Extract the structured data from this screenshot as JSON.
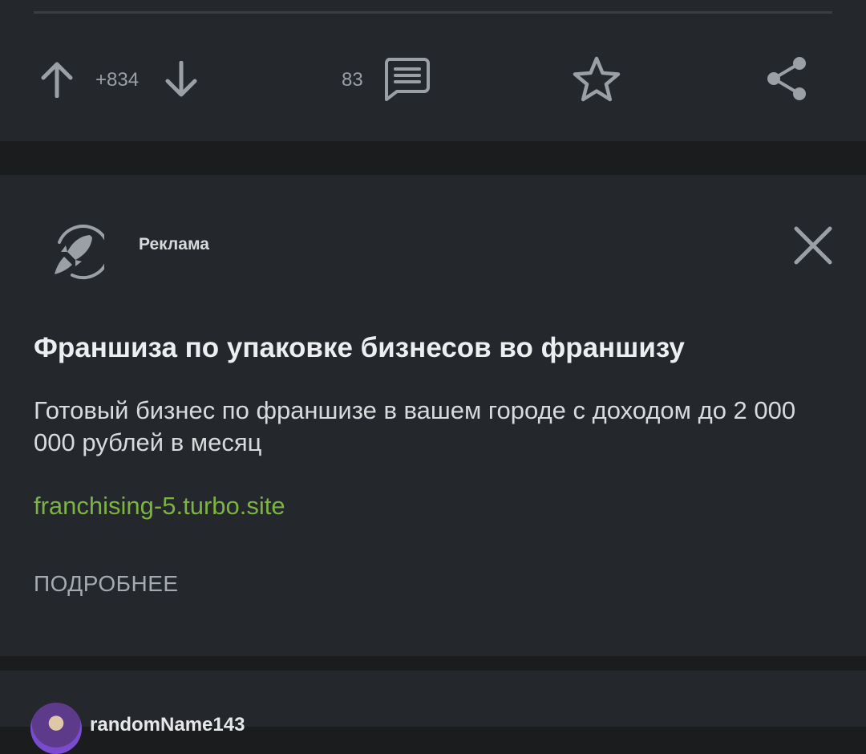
{
  "post": {
    "rating": "+834",
    "comments_count": "83",
    "icons": [
      "upvote-arrow-icon",
      "downvote-arrow-icon",
      "comments-icon",
      "star-icon",
      "share-icon"
    ]
  },
  "ad": {
    "label": "Реклама",
    "title": "Франшиза по упаковке бизнесов во франшизу",
    "description": "Готовый бизнес по франшизе в вашем городе с доходом до 2 000 000 рублей в месяц",
    "link_text": "franchising-5.turbo.site",
    "more_label": "ПОДРОБНЕЕ",
    "icons": [
      "rocket-icon",
      "close-icon"
    ]
  },
  "next_post": {
    "author": "randomName143"
  },
  "colors": {
    "background": "#1b1c1e",
    "card": "#24272b",
    "link": "#7cb342",
    "icon": "#9aa0a6"
  }
}
